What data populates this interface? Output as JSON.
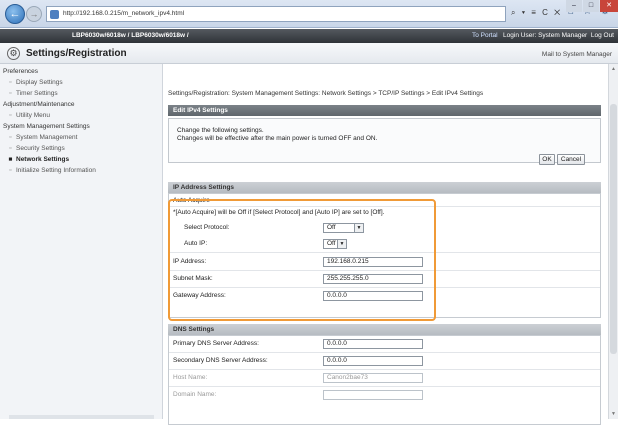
{
  "browser": {
    "url": "http://192.168.0.215/m_network_ipv4.html",
    "back_icon": "back-arrow-icon",
    "controls": "⌕ ▾ ≡ C ✕",
    "tab_icons": "⌂ ☆ ⚙",
    "window_min": "–",
    "window_max": "□",
    "window_close": "✕"
  },
  "topbar": {
    "device": "LBP6030w/6018w / LBP6030w/6018w /",
    "portal": "To Portal",
    "login": "Login User: System Manager",
    "logout": "Log Out"
  },
  "header": {
    "title": "Settings/Registration",
    "mail": "Mail to System Manager"
  },
  "sidebar": {
    "items": [
      {
        "label": "Preferences",
        "type": "group"
      },
      {
        "label": "Display Settings",
        "type": "item"
      },
      {
        "label": "Timer Settings",
        "type": "item"
      },
      {
        "label": "Adjustment/Maintenance",
        "type": "group"
      },
      {
        "label": "Utility Menu",
        "type": "item"
      },
      {
        "label": "System Management Settings",
        "type": "group"
      },
      {
        "label": "System Management",
        "type": "item"
      },
      {
        "label": "Security Settings",
        "type": "item"
      },
      {
        "label": "Network Settings",
        "type": "item",
        "active": true
      },
      {
        "label": "Initialize Setting Information",
        "type": "item"
      }
    ]
  },
  "main": {
    "breadcrumb": "Settings/Registration: System Management Settings: Network Settings > TCP/IP Settings > Edit IPv4 Settings",
    "section_title": "Edit IPv4 Settings",
    "message_line1": "Change the following settings.",
    "message_line2": "Changes will be effective after the main power is turned OFF and ON.",
    "ok_label": "OK",
    "cancel_label": "Cancel",
    "ip": {
      "title": "IP Address Settings",
      "auto_acquire": "Auto Acquire",
      "note": "*[Auto Acquire] will be Off if [Select Protocol] and [Auto IP] are set to [Off].",
      "select_protocol_label": "Select Protocol:",
      "select_protocol_value": "Off",
      "auto_ip_label": "Auto IP:",
      "auto_ip_value": "Off",
      "ip_address_label": "IP Address:",
      "ip_address_value": "192.168.0.215",
      "subnet_label": "Subnet Mask:",
      "subnet_value": "255.255.255.0",
      "gateway_label": "Gateway Address:",
      "gateway_value": "0.0.0.0"
    },
    "dns": {
      "title": "DNS Settings",
      "primary_label": "Primary DNS Server Address:",
      "primary_value": "0.0.0.0",
      "secondary_label": "Secondary DNS Server Address:",
      "secondary_value": "0.0.0.0",
      "host_label": "Host Name:",
      "host_value": "Canon2bae73",
      "domain_label": "Domain Name:",
      "domain_value": ""
    }
  },
  "colors": {
    "highlight": "#f09a37",
    "topbar": "#3a3e43",
    "section": "#6b7278"
  }
}
